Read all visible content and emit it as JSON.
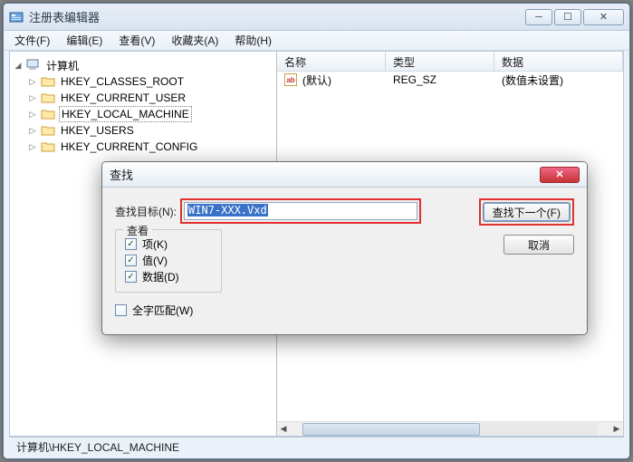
{
  "window": {
    "title": "注册表编辑器",
    "status_path": "计算机\\HKEY_LOCAL_MACHINE"
  },
  "menus": {
    "file": "文件(F)",
    "edit": "编辑(E)",
    "view": "查看(V)",
    "fav": "收藏夹(A)",
    "help": "帮助(H)"
  },
  "tree": {
    "root": "计算机",
    "items": [
      {
        "label": "HKEY_CLASSES_ROOT"
      },
      {
        "label": "HKEY_CURRENT_USER"
      },
      {
        "label": "HKEY_LOCAL_MACHINE",
        "selected": true
      },
      {
        "label": "HKEY_USERS"
      },
      {
        "label": "HKEY_CURRENT_CONFIG"
      }
    ]
  },
  "list": {
    "headers": {
      "name": "名称",
      "type": "类型",
      "data": "数据"
    },
    "rows": [
      {
        "name": "(默认)",
        "type": "REG_SZ",
        "data": "(数值未设置)"
      }
    ]
  },
  "dialog": {
    "title": "查找",
    "target_label": "查找目标(N):",
    "target_value": "WIN7-XXX.Vxd",
    "group_label": "查看",
    "opt_key": "项(K)",
    "opt_value": "值(V)",
    "opt_data": "数据(D)",
    "whole_word": "全字匹配(W)",
    "find_next": "查找下一个(F)",
    "cancel": "取消"
  }
}
